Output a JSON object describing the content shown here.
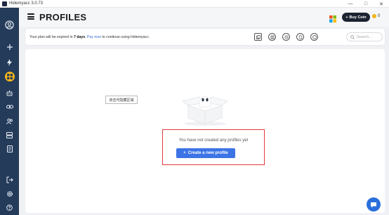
{
  "window": {
    "title": "Hidemyacc 3.0.73",
    "controls": {
      "minimize": "—",
      "maximize": "□",
      "close": "✕"
    }
  },
  "sidebar": {
    "items": [
      {
        "name": "account",
        "icon": "user-circle-icon"
      },
      {
        "name": "add",
        "icon": "plus-icon"
      },
      {
        "name": "automation",
        "icon": "lightning-icon"
      },
      {
        "name": "profiles",
        "icon": "grid-icon",
        "active": true
      },
      {
        "name": "bot",
        "icon": "robot-icon"
      },
      {
        "name": "proxy",
        "icon": "link-icon"
      },
      {
        "name": "team",
        "icon": "users-icon"
      },
      {
        "name": "storage",
        "icon": "database-icon"
      },
      {
        "name": "notes",
        "icon": "document-icon"
      },
      {
        "name": "exit",
        "icon": "logout-icon"
      },
      {
        "name": "settings",
        "icon": "gear-icon"
      },
      {
        "name": "help",
        "icon": "help-icon"
      }
    ]
  },
  "header": {
    "title": "PROFILES",
    "buy_coin_label": "Buy Coin",
    "coin_balance": "0"
  },
  "notice": {
    "prefix": "Your plan will be expired in ",
    "days": "7 days",
    "middle": ". ",
    "link": "Pay now",
    "suffix": " to continue using Hidemyacc."
  },
  "toolbar": {
    "icons": [
      "copy-icon",
      "plugin-icon",
      "history-icon",
      "sync-icon",
      "shield-icon"
    ]
  },
  "search": {
    "placeholder": "Search..."
  },
  "content": {
    "floating_label": "双击可隐藏区域",
    "empty_message": "You have not created any profiles yet",
    "create_button": "Create a new profile"
  },
  "colors": {
    "sidebar_bg": "#243b5a",
    "active_icon_bg": "#f3b41b",
    "primary": "#3c74e6",
    "highlight": "#e23b3b",
    "buy_coin_bg": "#1c2331"
  }
}
